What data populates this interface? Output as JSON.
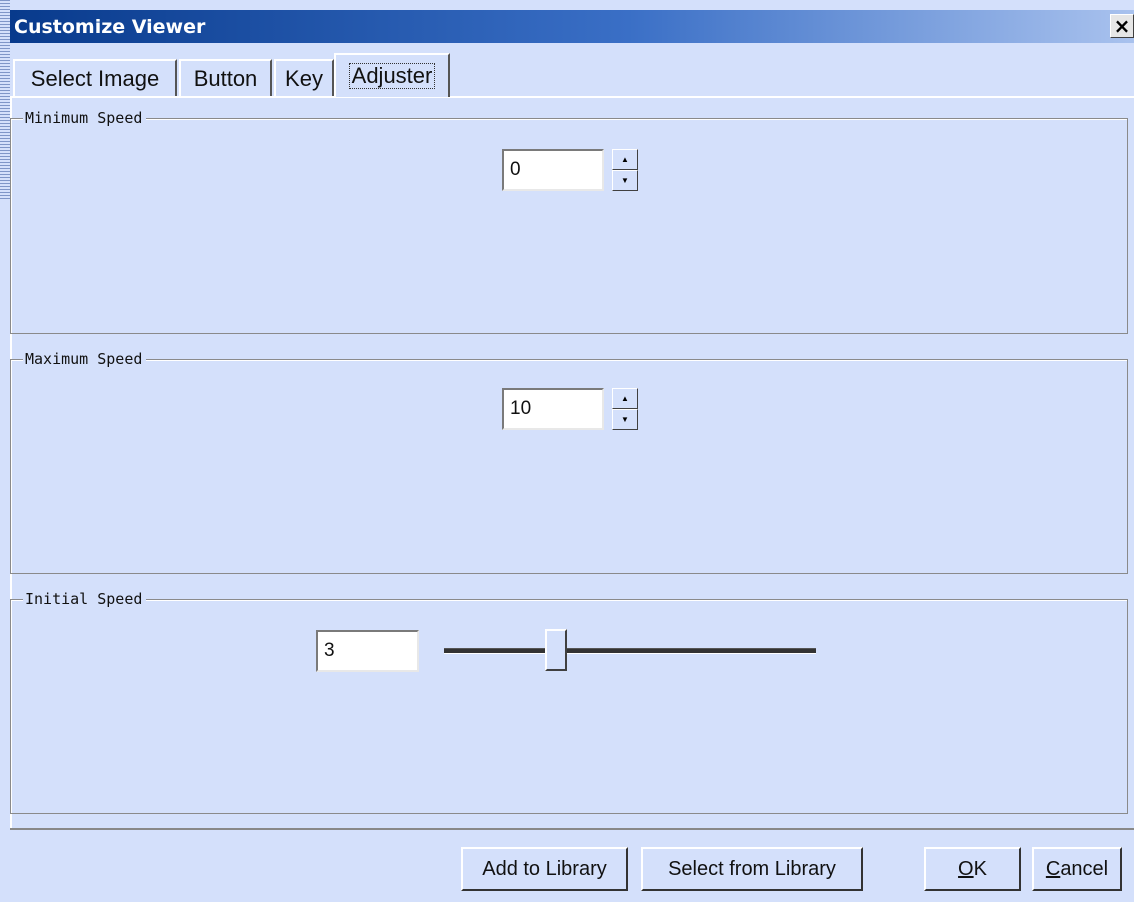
{
  "window": {
    "title": "Customize Viewer",
    "close_glyph": "×"
  },
  "tabs": [
    {
      "label": "Select Image"
    },
    {
      "label": "Button"
    },
    {
      "label": "Key"
    },
    {
      "label": "Adjuster",
      "active": true
    }
  ],
  "groups": {
    "minimum": {
      "label": "Minimum Speed",
      "value": "0"
    },
    "maximum": {
      "label": "Maximum Speed",
      "value": "10"
    },
    "initial": {
      "label": "Initial Speed",
      "value": "3",
      "slider_fraction": 0.3
    }
  },
  "spinner_icons": {
    "up": "▲",
    "down": "▼"
  },
  "buttons": {
    "add_to_library": "Add to Library",
    "select_from_library": "Select from Library",
    "ok_accel": "O",
    "ok_rest": "K",
    "cancel_accel": "C",
    "cancel_rest": "ancel"
  },
  "colors": {
    "background": "#d4e0fb",
    "titlebar": "#083a8c"
  }
}
